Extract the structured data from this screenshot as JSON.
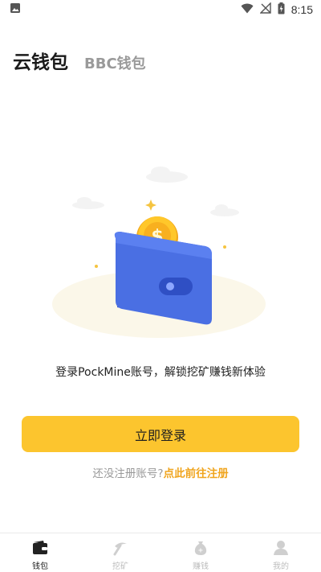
{
  "status_bar": {
    "time": "8:15"
  },
  "header": {
    "tabs": [
      {
        "label": "云钱包",
        "active": true
      },
      {
        "label": "BBC钱包",
        "active": false
      }
    ]
  },
  "main": {
    "prompt": "登录PockMine账号，解锁挖矿赚钱新体验",
    "login_button": "立即登录",
    "register_hint": "还没注册账号?",
    "register_link": "点此前往注册"
  },
  "bottom_nav": {
    "items": [
      {
        "label": "钱包",
        "icon": "wallet-icon",
        "active": true
      },
      {
        "label": "挖矿",
        "icon": "pickaxe-icon",
        "active": false
      },
      {
        "label": "赚钱",
        "icon": "money-bag-icon",
        "active": false
      },
      {
        "label": "我的",
        "icon": "profile-icon",
        "active": false
      }
    ]
  },
  "colors": {
    "accent": "#fcc52e",
    "link": "#f0a51e",
    "wallet": "#4a6fe3",
    "coin": "#f7b21b"
  }
}
